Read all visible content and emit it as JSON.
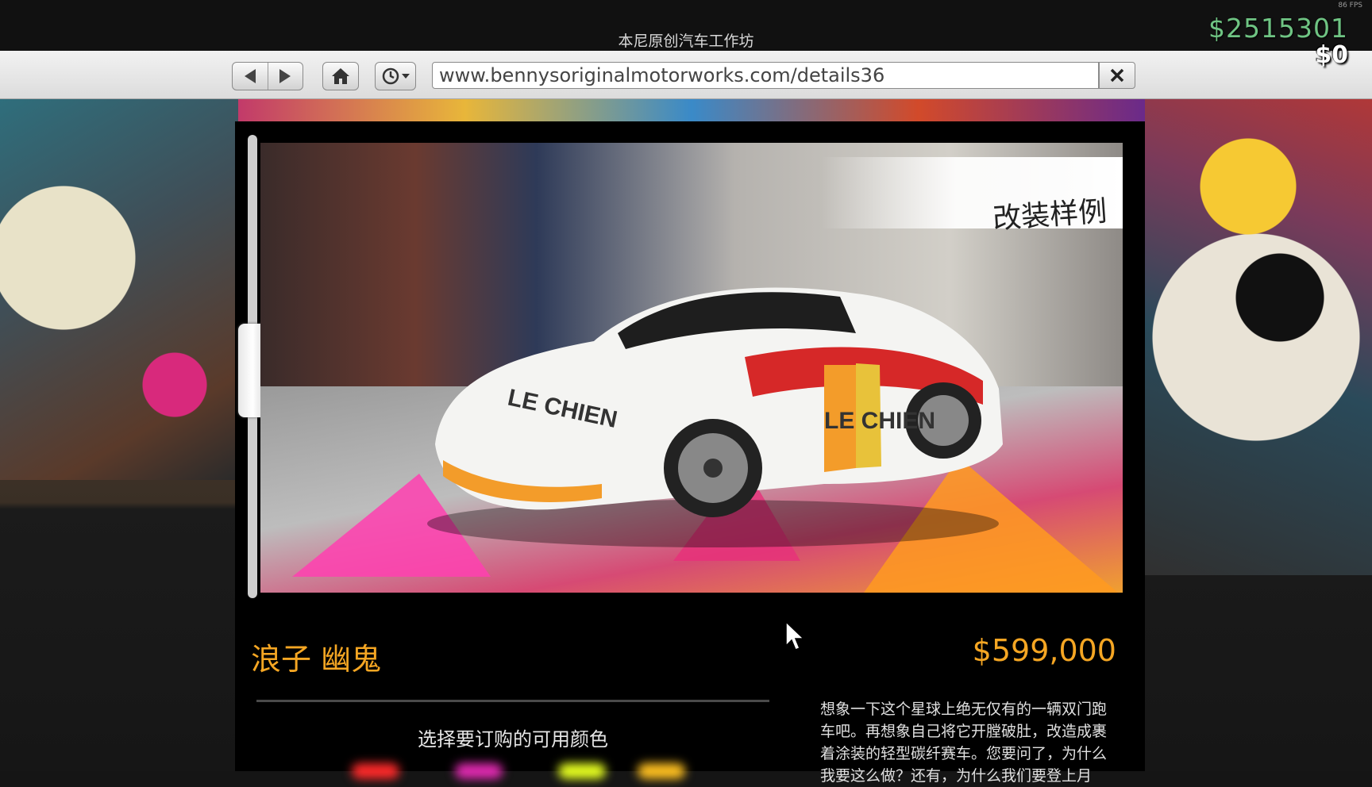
{
  "window": {
    "title": "本尼原创汽车工作坊",
    "fps": "86 FPS",
    "bank_balance": "$2515301",
    "cash_balance": "$0"
  },
  "toolbar": {
    "back_icon": "back-arrow-icon",
    "forward_icon": "forward-arrow-icon",
    "home_icon": "home-icon",
    "history_icon": "history-clock-icon",
    "url": "www.bennysoriginalmotorworks.com/details36",
    "close_icon": "close-icon"
  },
  "vehicle": {
    "badge": "改装样例",
    "name": "浪子 幽鬼",
    "price": "$599,000",
    "color_heading": "选择要订购的可用颜色",
    "color_swatches": [
      "#ff2a2a",
      "#e02ab0",
      "#e6ff20",
      "#ffc020"
    ],
    "description": "想象一下这个星球上绝无仅有的一辆双门跑车吧。再想象自己将它开膛破肚，改造成裹着涂装的轻型碳纤赛车。您要问了，为什么我要这么做？还有，为什么我们要登上月"
  }
}
